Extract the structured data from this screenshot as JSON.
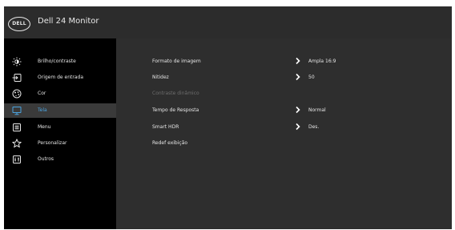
{
  "header": {
    "logo_text": "DELL",
    "title": "Dell 24 Monitor"
  },
  "sidebar": {
    "items": [
      {
        "label": "Brilho/contraste",
        "icon": "brightness-icon"
      },
      {
        "label": "Origem de entrada",
        "icon": "input-source-icon"
      },
      {
        "label": "Cor",
        "icon": "color-icon"
      },
      {
        "label": "Tela",
        "icon": "display-icon",
        "active": true
      },
      {
        "label": "Menu",
        "icon": "menu-icon"
      },
      {
        "label": "Personalizar",
        "icon": "star-icon"
      },
      {
        "label": "Outros",
        "icon": "others-icon"
      }
    ]
  },
  "main": {
    "rows": [
      {
        "label": "Formato de imagem",
        "value": "Ampla 16:9"
      },
      {
        "label": "Nitidez",
        "value": "50"
      },
      {
        "label": "Contraste dinâmico",
        "disabled": true
      },
      {
        "label": "Tempo de Resposta",
        "value": "Normal"
      },
      {
        "label": "Smart HDR",
        "value": "Des."
      },
      {
        "label": "Redef exibição"
      }
    ]
  },
  "colors": {
    "accent": "#4aa3df",
    "header_bg": "#2c2c2c",
    "panel_bg": "#2e2e2e",
    "sidebar_bg": "#000000"
  }
}
